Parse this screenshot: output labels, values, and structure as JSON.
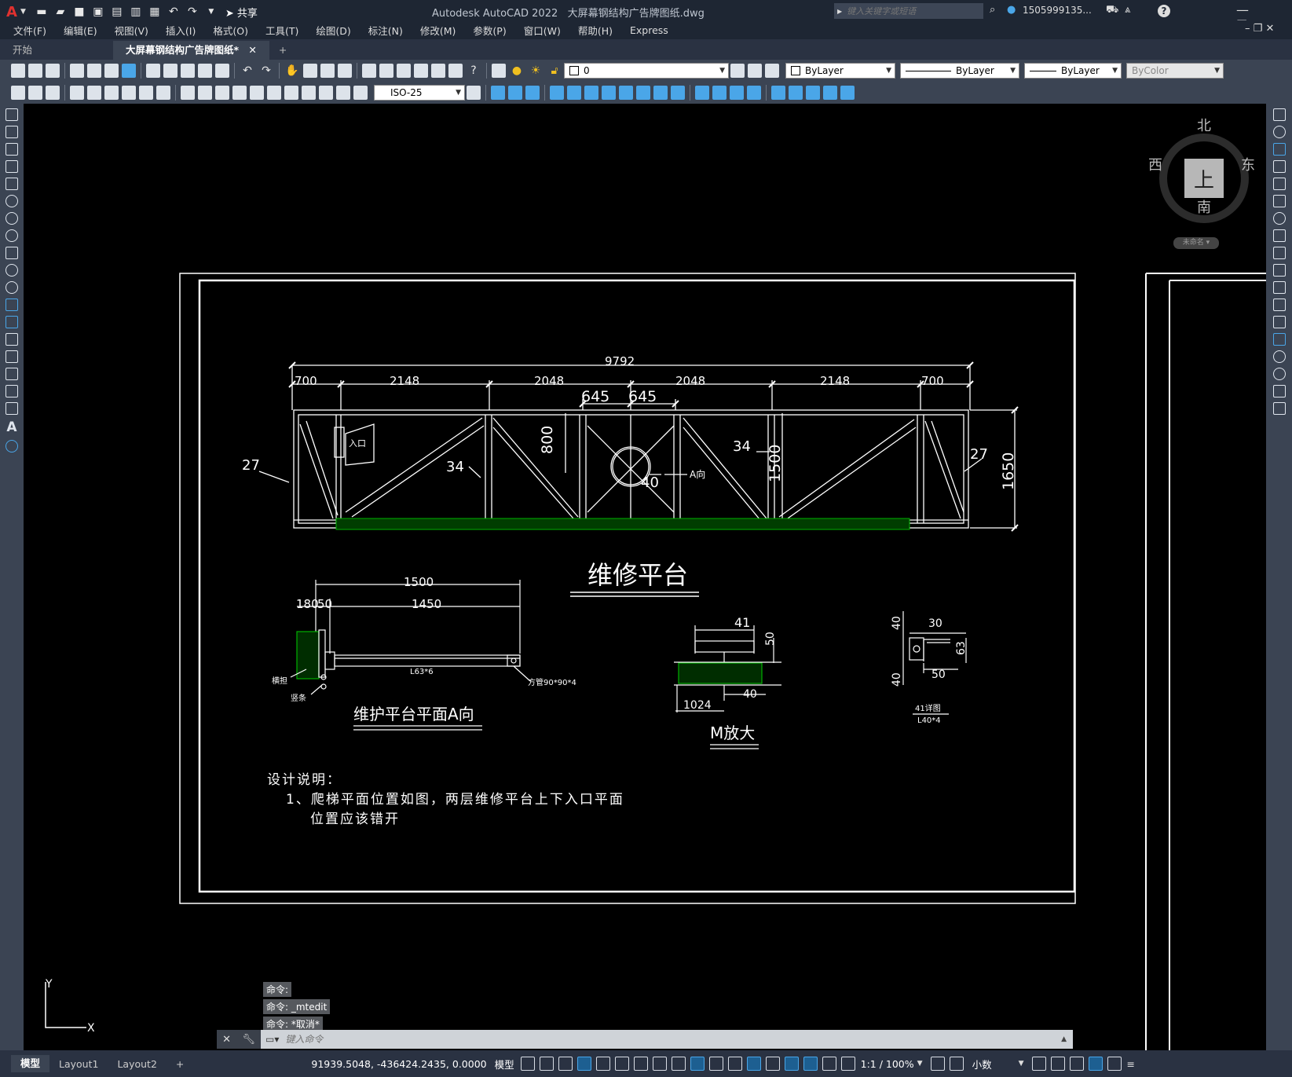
{
  "title_bar": {
    "app_title": "Autodesk AutoCAD 2022",
    "file_title": "大屏幕钢结构广告牌图纸.dwg",
    "share_label": "共享",
    "search_placeholder": "键入关键字或短语",
    "user_name": "1505999135...",
    "help_label": "?"
  },
  "menu": [
    "文件(F)",
    "编辑(E)",
    "视图(V)",
    "插入(I)",
    "格式(O)",
    "工具(T)",
    "绘图(D)",
    "标注(N)",
    "修改(M)",
    "参数(P)",
    "窗口(W)",
    "帮助(H)",
    "Express"
  ],
  "tabs": {
    "start": "开始",
    "drawing": "大屏幕钢结构广告牌图纸*",
    "close": "✕",
    "add": "+"
  },
  "toolbar": {
    "layer_value": "0",
    "color_value": "ByLayer",
    "linetype_value": "ByLayer",
    "lineweight_value": "ByLayer",
    "plotstyle_value": "ByColor",
    "dimstyle_value": "ISO-25"
  },
  "viewcube": {
    "north": "北",
    "south": "南",
    "east": "东",
    "west": "西",
    "face": "上",
    "wcs": "未命名"
  },
  "ucs": {
    "x": "X",
    "y": "Y"
  },
  "drawing": {
    "main_dims": {
      "total": "9792",
      "segments": [
        "700",
        "2148",
        "2048",
        "2048",
        "2148",
        "700"
      ],
      "center": [
        "645",
        "645"
      ],
      "height": "1650",
      "inner_height": "1500",
      "v800": "800",
      "member27a": "27",
      "member27b": "27",
      "member34a": "34",
      "member34b": "34",
      "member40": "40",
      "arrow_a": "A向",
      "entrance": "入口"
    },
    "main_title": "维修平台",
    "section_a": {
      "d1500": "1500",
      "d1450": "1450",
      "d180": "180",
      "d50": "50",
      "angle": "L63*6",
      "tube": "方管90*90*4",
      "rail": "横担",
      "post": "竖条",
      "title": "维护平台平面A向"
    },
    "detail_m": {
      "d41": "41",
      "d50": "50",
      "d40": "40",
      "d1024": "1024",
      "title": "M放大"
    },
    "detail_41": {
      "d40a": "40",
      "d30": "30",
      "d63": "63",
      "d40b": "40",
      "d50": "50",
      "title1": "41详图",
      "title2": "L40*4"
    },
    "notes": {
      "heading": "设计说明：",
      "line1": "1、爬梯平面位置如图，两层维修平台上下入口平面",
      "line2": "位置应该错开"
    }
  },
  "command": {
    "history": [
      "命令:",
      "命令: _mtedit",
      "命令: *取消*"
    ],
    "placeholder": "键入命令"
  },
  "status": {
    "tabs": [
      "模型",
      "Layout1",
      "Layout2"
    ],
    "add": "+",
    "coords": "91939.5048, -436424.2435, 0.0000",
    "space": "模型",
    "scale": "1:1 / 100%",
    "units": "小数"
  },
  "colors": {
    "accent": "#4aa6e8",
    "hatch": "#00a000",
    "ui_dark": "#1e2633",
    "ui_mid": "#3b4453"
  }
}
